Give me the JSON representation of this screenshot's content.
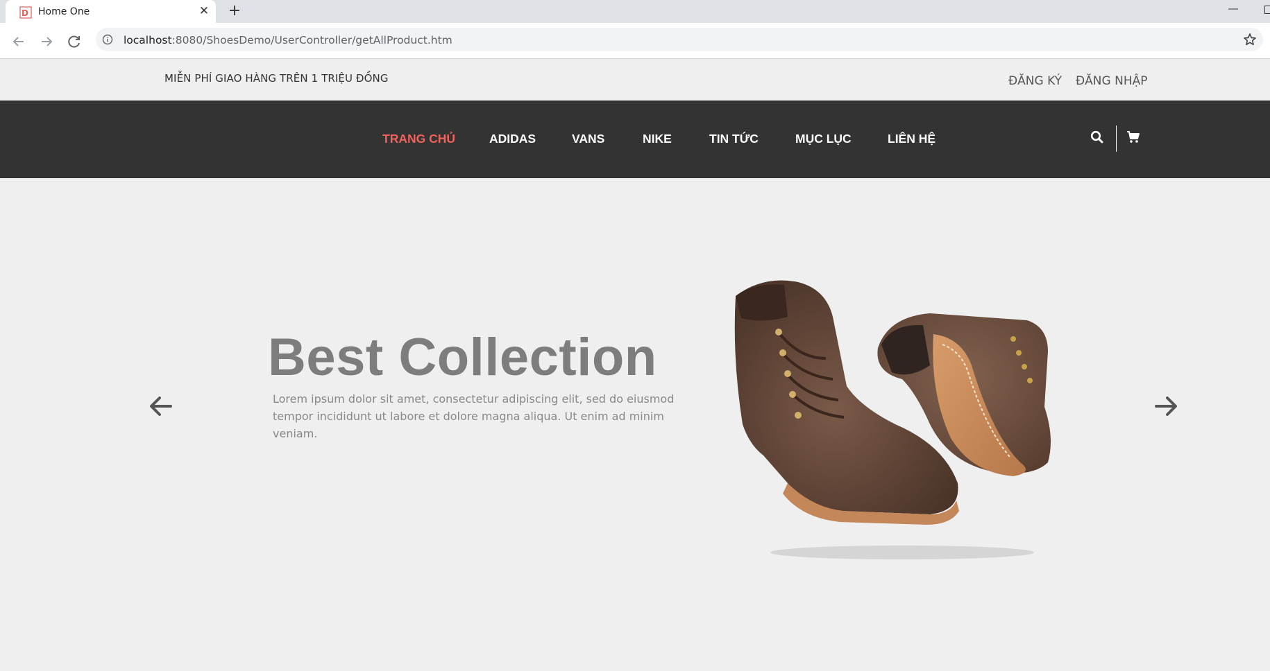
{
  "browser": {
    "tab_title": "Home One",
    "url_host": "localhost",
    "url_path": ":8080/ShoesDemo/UserController/getAllProduct.htm"
  },
  "topbar": {
    "free_shipping": "MIỄN PHÍ GIAO HÀNG TRÊN 1 TRIỆU ĐỒNG",
    "register": "ĐĂNG KÝ",
    "login": "ĐĂNG NHẬP"
  },
  "nav": {
    "items": [
      "TRANG CHỦ",
      "ADIDAS",
      "VANS",
      "NIKE",
      "TIN TỨC",
      "MỤC LỤC",
      "LIÊN HỆ"
    ],
    "active_color": "#f0625b"
  },
  "hero": {
    "title": "Best Collection",
    "text": "Lorem ipsum dolor sit amet, consectetur adipiscing elit, sed do eiusmod tempor incididunt ut labore et dolore magna aliqua. Ut enim ad minim veniam.",
    "image": "brown-leather-boots"
  }
}
